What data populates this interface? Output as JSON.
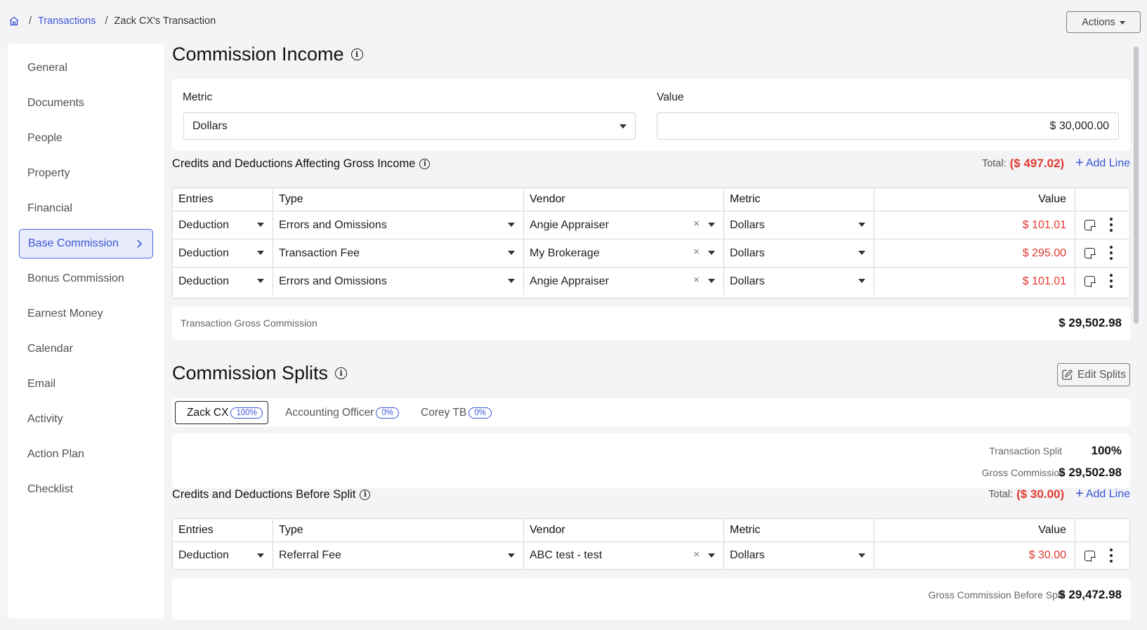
{
  "breadcrumb": {
    "home_icon": "home-icon",
    "sep": "/",
    "parent": "Transactions",
    "current": "Zack CX's Transaction"
  },
  "actions_label": "Actions",
  "sidebar": {
    "items": [
      {
        "label": "General"
      },
      {
        "label": "Documents"
      },
      {
        "label": "People"
      },
      {
        "label": "Property"
      },
      {
        "label": "Financial"
      },
      {
        "label": "Base Commission",
        "active": true
      },
      {
        "label": "Bonus Commission"
      },
      {
        "label": "Earnest Money"
      },
      {
        "label": "Calendar"
      },
      {
        "label": "Email"
      },
      {
        "label": "Activity"
      },
      {
        "label": "Action Plan"
      },
      {
        "label": "Checklist"
      }
    ]
  },
  "commission_income": {
    "title": "Commission Income",
    "metric_label": "Metric",
    "metric_value": "Dollars",
    "value_label": "Value",
    "value": "$ 30,000.00"
  },
  "gross_deductions": {
    "title": "Credits and Deductions Affecting Gross Income",
    "total_label": "Total:",
    "total": "($ 497.02)",
    "add_line": "Add Line",
    "headers": {
      "entries": "Entries",
      "type": "Type",
      "vendor": "Vendor",
      "metric": "Metric",
      "value": "Value"
    },
    "rows": [
      {
        "entries": "Deduction",
        "type": "Errors and Omissions",
        "vendor": "Angie Appraiser",
        "metric": "Dollars",
        "value": "$ 101.01"
      },
      {
        "entries": "Deduction",
        "type": "Transaction Fee",
        "vendor": "My Brokerage",
        "metric": "Dollars",
        "value": "$ 295.00"
      },
      {
        "entries": "Deduction",
        "type": "Errors and Omissions",
        "vendor": "Angie Appraiser",
        "metric": "Dollars",
        "value": "$ 101.01"
      }
    ],
    "summary_label": "Transaction Gross Commission",
    "summary_value": "$ 29,502.98"
  },
  "commission_splits": {
    "title": "Commission Splits",
    "edit_label": "Edit Splits",
    "tabs": [
      {
        "name": "Zack CX",
        "pct": "100%",
        "active": true
      },
      {
        "name": "Accounting Officer",
        "pct": "0%"
      },
      {
        "name": "Corey TB",
        "pct": "0%"
      }
    ],
    "transaction_split_label": "Transaction Split",
    "transaction_split_value": "100%",
    "gross_commission_label": "Gross Commission",
    "gross_commission_value": "$ 29,502.98"
  },
  "before_split": {
    "title": "Credits and Deductions Before Split",
    "total_label": "Total:",
    "total": "($ 30.00)",
    "add_line": "Add Line",
    "headers": {
      "entries": "Entries",
      "type": "Type",
      "vendor": "Vendor",
      "metric": "Metric",
      "value": "Value"
    },
    "rows": [
      {
        "entries": "Deduction",
        "type": "Referral Fee",
        "vendor": "ABC test - test",
        "metric": "Dollars",
        "value": "$ 30.00"
      }
    ],
    "summary_label": "Gross Commission Before Split",
    "summary_value": "$ 29,472.98"
  },
  "colors": {
    "accent": "#3a56d4",
    "negative": "#e03a2e",
    "background": "#f4f4f6"
  }
}
